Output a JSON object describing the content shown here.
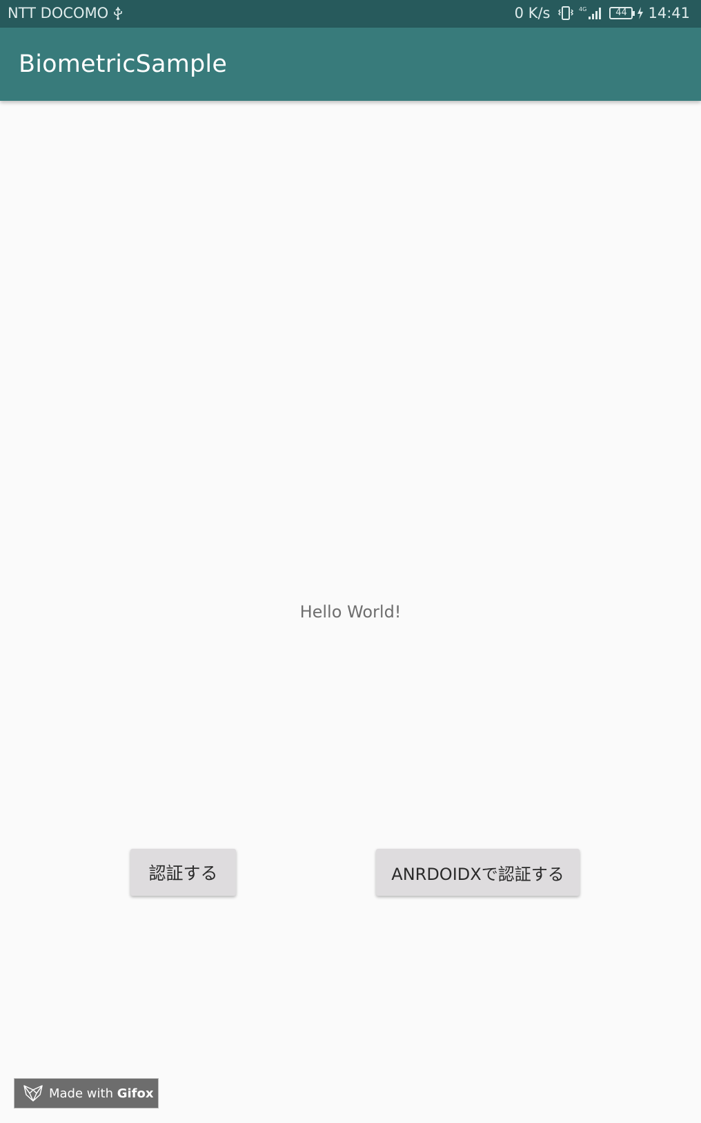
{
  "status_bar": {
    "carrier": "NTT DOCOMO",
    "net_speed": "0 K/s",
    "network_type": "4G",
    "battery": "44",
    "time": "14:41",
    "icons": [
      "usb-icon",
      "vibrate-icon",
      "signal-icon",
      "battery-icon",
      "charging-icon"
    ]
  },
  "app_bar": {
    "title": "BiometricSample",
    "color": "#387b7b"
  },
  "main": {
    "hello_text": "Hello World!"
  },
  "buttons": {
    "auth_label": "認証する",
    "androidx_label": "ANRDOIDXで認証する"
  },
  "watermark": {
    "prefix": "Made with",
    "brand": "Gifox"
  }
}
